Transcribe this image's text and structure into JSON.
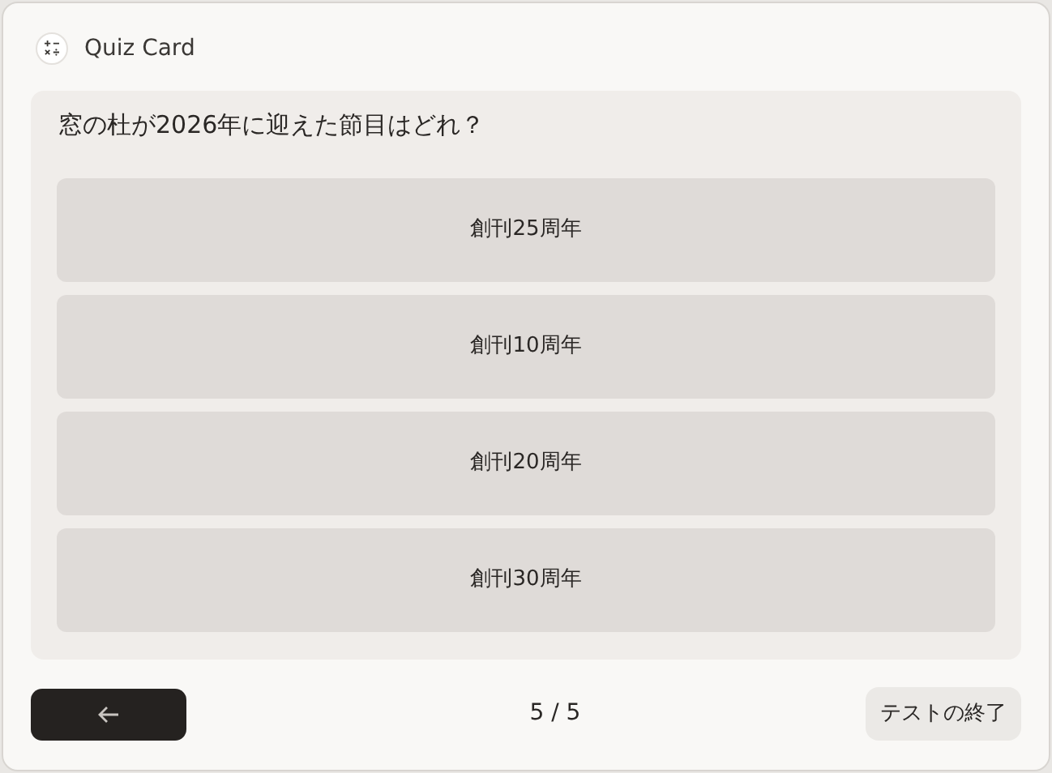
{
  "window": {
    "title": "Quiz Card"
  },
  "question": "窓の杜が2026年に迎えた節目はどれ？",
  "options": [
    {
      "label": "創刊25周年"
    },
    {
      "label": "創刊10周年"
    },
    {
      "label": "創刊20周年"
    },
    {
      "label": "創刊30周年"
    }
  ],
  "footer": {
    "progress": "5 / 5",
    "finish_button": "テストの終了"
  }
}
